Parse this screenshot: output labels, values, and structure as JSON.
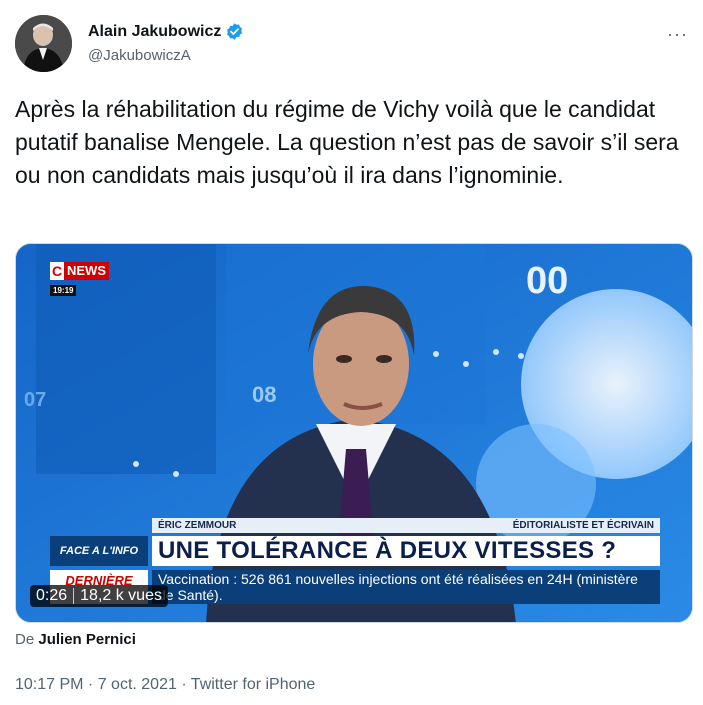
{
  "author": {
    "name": "Alain Jakubowicz",
    "handle": "@JakubowiczA",
    "avatar_icon": "avatar",
    "verified_icon": "verified-badge-icon",
    "verified_color": "#1d9bf0"
  },
  "more_label": "···",
  "tweet": {
    "text": "Après la réhabilitation du régime de Vichy voilà que le candidat putatif banalise Mengele. La question n’est pas de savoir s’il sera ou non candidats mais jusqu’où il ira dans l’ignominie."
  },
  "media": {
    "channel_c": "C",
    "channel_news": "NEWS",
    "clock": "19:19",
    "studio_numbers": [
      "00",
      "07",
      "08"
    ],
    "lower_third": {
      "speaker": "ÉRIC ZEMMOUR",
      "role": "ÉDITORIALISTE ET ÉCRIVAIN",
      "show": "FACE A L'INFO",
      "headline": "UNE TOLÉRANCE À DEUX VITESSES ?",
      "ticker_label": "DERNIÈRE",
      "ticker": "Vaccination : 526 861 nouvelles injections ont été réalisées en 24H (ministère de Santé)."
    },
    "duration": "0:26",
    "views": "18,2 k vues"
  },
  "attribution": {
    "prefix": "De",
    "name": "Julien Pernici"
  },
  "meta": "10:17 PM · 7 oct. 2021 · Twitter for iPhone",
  "colors": {
    "text": "#0f1419",
    "secondary": "#536471",
    "channel_red": "#d00000",
    "banner_blue": "#0a3f7a"
  }
}
